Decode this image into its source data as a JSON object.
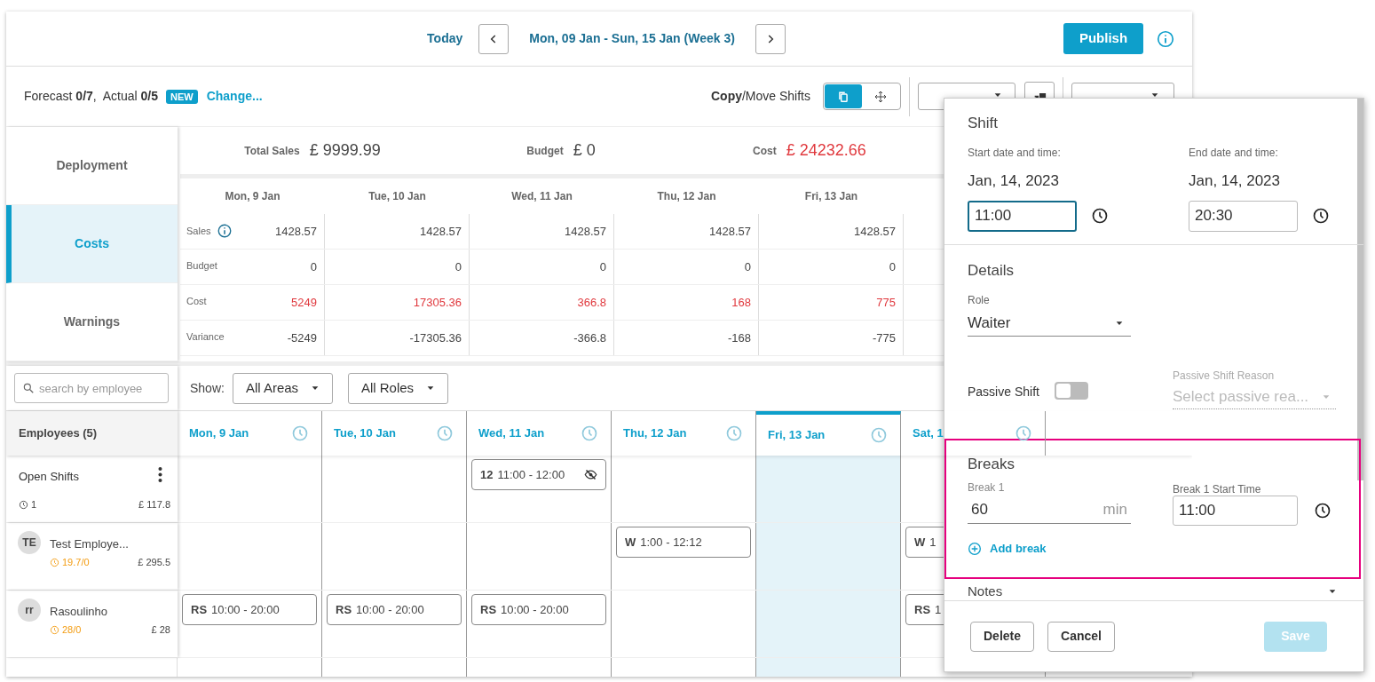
{
  "header": {
    "today": "Today",
    "date_range": "Mon, 09 Jan - Sun, 15 Jan (Week 3)",
    "publish": "Publish"
  },
  "toolbar": {
    "summary": "Forecast **0/7**,  Actual **0/5**",
    "badge": "NEW",
    "change_link": "Change...",
    "copy_move": "**Copy**/Move Shifts",
    "mode_buttons": [
      {
        "kind": "copy",
        "selected": true
      },
      {
        "kind": "move",
        "selected": false
      }
    ],
    "roles_filter": true,
    "actions": true
  },
  "nav": [
    {
      "label": "Deployment",
      "selected": false
    },
    {
      "label": "Costs",
      "selected": true
    },
    {
      "label": "Warnings",
      "selected": false
    }
  ],
  "totals": [
    {
      "label": "Total Sales",
      "value": "£ 9999.99",
      "over_budget": false
    },
    {
      "label": "Budget",
      "value": "£ 0",
      "over_budget": false
    },
    {
      "label": "Cost",
      "value": "£ 24232.66",
      "over_budget": true
    }
  ],
  "cost_table": {
    "columns": [
      "Mon, 9 Jan",
      "Tue, 10 Jan",
      "Wed, 11 Jan",
      "Thu, 12 Jan",
      "Fri, 13 Jan"
    ],
    "rows": [
      {
        "label": "Sales",
        "info": true,
        "over_budget": false,
        "values": [
          "1428.57",
          "1428.57",
          "1428.57",
          "1428.57",
          "1428.57"
        ]
      },
      {
        "label": "Budget",
        "info": false,
        "over_budget": false,
        "values": [
          "0",
          "0",
          "0",
          "0",
          "0"
        ]
      },
      {
        "label": "Cost",
        "info": false,
        "over_budget": true,
        "values": [
          "5249",
          "17305.36",
          "366.8",
          "168",
          "775"
        ]
      },
      {
        "label": "Variance",
        "info": false,
        "over_budget": false,
        "values": [
          "-5249",
          "-17305.36",
          "-366.8",
          "-168",
          "-775"
        ]
      }
    ]
  },
  "schedule": {
    "search_placeholder": "search by employee",
    "show_label": "Show:",
    "filters": [
      "All Areas",
      "All Roles"
    ],
    "employees_header": "Employees (5)",
    "days": [
      {
        "label": "Mon, 9 Jan",
        "selected": false
      },
      {
        "label": "Tue, 10 Jan",
        "selected": false
      },
      {
        "label": "Wed, 11 Jan",
        "selected": false
      },
      {
        "label": "Thu, 12 Jan",
        "selected": false
      },
      {
        "label": "Fri, 13 Jan",
        "selected": true
      },
      {
        "label": "Sat, 1",
        "selected": false
      }
    ],
    "rows": [
      {
        "kind": "open",
        "name": "Open Shifts",
        "count": "1",
        "cost": "£ 117.8",
        "shifts": [
          {
            "kind": "empty"
          },
          {
            "kind": "empty"
          },
          {
            "kind": "shift",
            "code": "12",
            "time": "11:00 - 12:00",
            "hidden": true
          },
          {
            "kind": "empty"
          },
          {
            "kind": "empty"
          },
          {
            "kind": "empty"
          }
        ]
      },
      {
        "kind": "employee",
        "initials": "TE",
        "name": "Test Employe...",
        "hours": "19.7/0",
        "cost": "£ 295.5",
        "shifts": [
          {
            "kind": "empty"
          },
          {
            "kind": "empty"
          },
          {
            "kind": "empty"
          },
          {
            "kind": "shift",
            "code": "W",
            "time": "1:00 - 12:12",
            "hidden": false
          },
          {
            "kind": "empty"
          },
          {
            "kind": "shift",
            "code": "W",
            "time": "1",
            "hidden": false
          }
        ]
      },
      {
        "kind": "employee",
        "initials": "rr",
        "name": "Rasoulinho",
        "hours": "28/0",
        "cost": "£ 28",
        "shifts": [
          {
            "kind": "shift",
            "code": "RS",
            "time": "10:00 - 20:00",
            "hidden": false
          },
          {
            "kind": "shift",
            "code": "RS",
            "time": "10:00 - 20:00",
            "hidden": false
          },
          {
            "kind": "shift",
            "code": "RS",
            "time": "10:00 - 20:00",
            "hidden": false
          },
          {
            "kind": "empty"
          },
          {
            "kind": "empty"
          },
          {
            "kind": "shift",
            "code": "RS",
            "time": "1",
            "hidden": false
          }
        ]
      }
    ]
  },
  "dialog": {
    "shift_title": "Shift",
    "start_label": "Start date and time:",
    "start_date": "Jan, 14, 2023",
    "start_time": "11:00",
    "start_focused": true,
    "end_label": "End date and time:",
    "end_date": "Jan, 14, 2023",
    "end_time": "20:30",
    "details_title": "Details",
    "role_label": "Role",
    "role": "Waiter",
    "passive_label": "Passive Shift",
    "passive_on": false,
    "passive_reason_label": "Passive Shift Reason",
    "passive_reason_placeholder": "Select passive rea...",
    "breaks_title": "Breaks",
    "breaks": [
      {
        "label": "Break 1",
        "minutes": "60",
        "unit": "min",
        "start_label": "Break 1 Start Time",
        "start": "11:00"
      }
    ],
    "add_break": "Add break",
    "notes_title": "Notes",
    "buttons": [
      {
        "label": "Delete",
        "kind": "secondary",
        "disabled": false
      },
      {
        "label": "Cancel",
        "kind": "secondary",
        "disabled": false
      },
      {
        "label": "Save",
        "kind": "primary",
        "disabled": true
      }
    ]
  }
}
